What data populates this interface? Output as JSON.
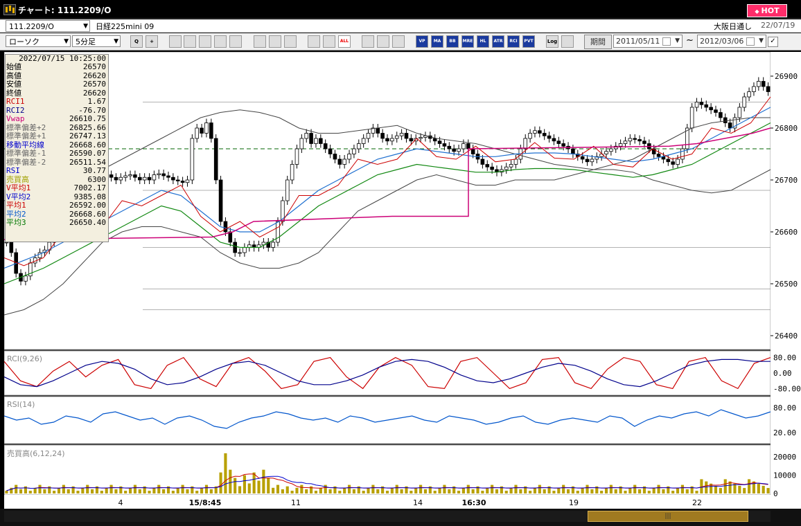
{
  "window": {
    "title": "チャート: 111.2209/O",
    "hot_label": "HOT"
  },
  "bar1": {
    "symbol_value": "111.2209/O",
    "symbol_name": "日経225mini 09",
    "exchange": "大阪日通し",
    "date": "22/07/19"
  },
  "toolbar": {
    "chart_type": "ローソク",
    "interval": "5分足",
    "period_label": "期間",
    "date_from": "2011/05/11",
    "date_to": "2012/03/06",
    "tilde": "~",
    "tools": [
      {
        "icon": "zoom-icon",
        "label": "Q"
      },
      {
        "icon": "crosshair-icon",
        "label": "+"
      },
      {
        "icon": "candle-tool-icon",
        "label": ""
      },
      {
        "icon": "target-icon",
        "label": ""
      },
      {
        "icon": "grid-icon",
        "label": ""
      },
      {
        "icon": "scale-icon",
        "label": ""
      },
      {
        "icon": "info-icon",
        "label": ""
      },
      {
        "icon": "pencil-icon",
        "label": ""
      },
      {
        "icon": "cursor-icon",
        "label": ""
      },
      {
        "icon": "redo-icon",
        "label": ""
      },
      {
        "icon": "zoom-out-icon",
        "label": ""
      },
      {
        "icon": "zoom-in-icon",
        "label": ""
      },
      {
        "icon": "all-icon",
        "label": "ALL"
      },
      {
        "icon": "settings-icon",
        "label": ""
      },
      {
        "icon": "wrench-icon",
        "label": ""
      },
      {
        "icon": "color-icon",
        "label": ""
      },
      {
        "icon": "vp-icon",
        "label": "VP"
      },
      {
        "icon": "ma-icon",
        "label": "MA"
      },
      {
        "icon": "bb-icon",
        "label": "BB"
      },
      {
        "icon": "mre-icon",
        "label": "MRE"
      },
      {
        "icon": "hl-icon",
        "label": "HL"
      },
      {
        "icon": "atr-icon",
        "label": "ATR"
      },
      {
        "icon": "rci-icon",
        "label": "RCI"
      },
      {
        "icon": "pvt-icon",
        "label": "PVT"
      },
      {
        "icon": "log-icon",
        "label": "Log"
      },
      {
        "icon": "export-icon",
        "label": ""
      }
    ]
  },
  "info_panel": {
    "datetime": "2022/07/15  10:25:00",
    "rows": [
      {
        "label": "始値",
        "value": "26570",
        "color": "#000000"
      },
      {
        "label": "高値",
        "value": "26620",
        "color": "#000000"
      },
      {
        "label": "安値",
        "value": "26570",
        "color": "#000000"
      },
      {
        "label": "終値",
        "value": "26620",
        "color": "#000000"
      },
      {
        "label": "RCI1",
        "value": "1.67",
        "color": "#cc0000"
      },
      {
        "label": "RCI2",
        "value": "-76.70",
        "color": "#00008b"
      },
      {
        "label": "Vwap",
        "value": "26610.75",
        "color": "#cc0077"
      },
      {
        "label": "標準偏差+2",
        "value": "26825.66",
        "color": "#666666"
      },
      {
        "label": "標準偏差+1",
        "value": "26747.13",
        "color": "#666666"
      },
      {
        "label": "移動平均線",
        "value": "26668.60",
        "color": "#0000cc"
      },
      {
        "label": "標準偏差-1",
        "value": "26590.07",
        "color": "#666666"
      },
      {
        "label": "標準偏差-2",
        "value": "26511.54",
        "color": "#666666"
      },
      {
        "label": "RSI",
        "value": "30.77",
        "color": "#0000cc"
      },
      {
        "label": "売買高",
        "value": "6300",
        "color": "#a0a000"
      },
      {
        "label": "V平均1",
        "value": "7002.17",
        "color": "#cc0000"
      },
      {
        "label": "V平均2",
        "value": "9385.08",
        "color": "#0000cc"
      },
      {
        "label": "平均1",
        "value": "26592.00",
        "color": "#cc0000"
      },
      {
        "label": "平均2",
        "value": "26668.60",
        "color": "#0055cc"
      },
      {
        "label": "平均3",
        "value": "26650.40",
        "color": "#007700"
      }
    ]
  },
  "chart_data": [
    {
      "type": "candlestick",
      "ylim": [
        26380,
        26940
      ],
      "y_ticks": [
        26900,
        26800,
        26700,
        26600,
        26500,
        26400
      ],
      "x_ticks": [
        "4",
        "15/8:45",
        "11",
        "14",
        "16:30",
        "19",
        "22"
      ],
      "x_tick_bold": [
        false,
        true,
        false,
        false,
        true,
        false,
        false
      ],
      "closes": [
        26580,
        26560,
        26520,
        26505,
        26515,
        26540,
        26550,
        26560,
        26565,
        26580,
        26590,
        26605,
        26620,
        26640,
        26650,
        26660,
        26670,
        26680,
        26690,
        26700,
        26705,
        26710,
        26705,
        26700,
        26705,
        26708,
        26710,
        26705,
        26700,
        26705,
        26700,
        26710,
        26712,
        26708,
        26705,
        26700,
        26698,
        26695,
        26700,
        26780,
        26800,
        26790,
        26810,
        26780,
        26700,
        26620,
        26600,
        26580,
        26560,
        26560,
        26570,
        26575,
        26570,
        26575,
        26580,
        26570,
        26580,
        26620,
        26660,
        26700,
        26730,
        26760,
        26780,
        26790,
        26770,
        26780,
        26770,
        26760,
        26750,
        26740,
        26730,
        26740,
        26750,
        26760,
        26770,
        26780,
        26790,
        26800,
        26790,
        26780,
        26775,
        26780,
        26785,
        26790,
        26780,
        26775,
        26780,
        26782,
        26785,
        26780,
        26775,
        26770,
        26765,
        26760,
        26755,
        26760,
        26770,
        26760,
        26750,
        26740,
        26730,
        26725,
        26720,
        26715,
        26720,
        26725,
        26730,
        26740,
        26760,
        26780,
        26790,
        26795,
        26790,
        26785,
        26780,
        26775,
        26770,
        26765,
        26760,
        26750,
        26745,
        26740,
        26735,
        26740,
        26745,
        26750,
        26755,
        26760,
        26765,
        26770,
        26775,
        26780,
        26778,
        26775,
        26770,
        26760,
        26750,
        26745,
        26740,
        26735,
        26730,
        26740,
        26760,
        26800,
        26840,
        26850,
        26845,
        26840,
        26835,
        26830,
        26820,
        26810,
        26800,
        26820,
        26840,
        26860,
        26870,
        26880,
        26890,
        26880,
        26870
      ],
      "bb_upper": [
        26660,
        26670,
        26680,
        26690,
        26700,
        26720,
        26740,
        26760,
        26780,
        26800,
        26820,
        26830,
        26835,
        26830,
        26820,
        26800,
        26790,
        26790,
        26795,
        26800,
        26805,
        26790,
        26780,
        26775,
        26770,
        26760,
        26750,
        26740,
        26730,
        26725,
        26720,
        26730,
        26740,
        26760,
        26780,
        26800,
        26810,
        26815,
        26820,
        26820
      ],
      "bb_lower": [
        26440,
        26450,
        26470,
        26500,
        26540,
        26580,
        26600,
        26610,
        26610,
        26600,
        26590,
        26560,
        26540,
        26530,
        26530,
        26540,
        26560,
        26600,
        26640,
        26660,
        26680,
        26700,
        26710,
        26700,
        26690,
        26690,
        26700,
        26700,
        26700,
        26710,
        26720,
        26720,
        26715,
        26700,
        26690,
        26680,
        26675,
        26680,
        26700,
        26720
      ],
      "ma": [
        26530,
        26545,
        26560,
        26580,
        26600,
        26620,
        26640,
        26660,
        26680,
        26670,
        26640,
        26610,
        26600,
        26600,
        26620,
        26650,
        26680,
        26700,
        26720,
        26740,
        26750,
        26760,
        26755,
        26750,
        26745,
        26745,
        26750,
        26752,
        26752,
        26750,
        26745,
        26740,
        26735,
        26740,
        26750,
        26760,
        26780,
        26800,
        26820,
        26840
      ],
      "vwap_steps": [
        [
          0,
          26585
        ],
        [
          300,
          26590
        ],
        [
          330,
          26600
        ],
        [
          360,
          26620
        ],
        [
          560,
          26630
        ],
        [
          670,
          26630
        ],
        [
          670,
          26760
        ],
        [
          960,
          26765
        ],
        [
          1000,
          26770
        ],
        [
          1080,
          26790
        ],
        [
          1106,
          26800
        ]
      ]
    },
    {
      "type": "line",
      "name_label": "RCI(9,26)",
      "y_ticks": [
        "80.00",
        "0.00",
        "-80.00"
      ],
      "series": [
        {
          "color": "#cc0000",
          "values": [
            60,
            -40,
            -70,
            10,
            60,
            -20,
            40,
            70,
            -60,
            -80,
            40,
            80,
            -30,
            -70,
            50,
            80,
            10,
            -80,
            -60,
            60,
            80,
            -20,
            -80,
            30,
            80,
            40,
            -70,
            -80,
            60,
            80,
            0,
            -80,
            -50,
            70,
            80,
            -50,
            -80,
            20,
            80,
            60,
            -60,
            -80,
            60,
            80,
            -40,
            -80,
            50,
            80
          ]
        },
        {
          "color": "#00008b",
          "values": [
            -20,
            -60,
            -70,
            -40,
            0,
            40,
            60,
            50,
            20,
            -30,
            -60,
            -50,
            -20,
            20,
            50,
            60,
            40,
            0,
            -40,
            -60,
            -60,
            -40,
            -10,
            30,
            60,
            70,
            60,
            30,
            -10,
            -40,
            -50,
            -30,
            0,
            30,
            50,
            40,
            10,
            -30,
            -60,
            -70,
            -40,
            0,
            40,
            60,
            70,
            70,
            60,
            60
          ]
        }
      ]
    },
    {
      "type": "line",
      "name_label": "RSI(14)",
      "y_ticks": [
        "80.00",
        "20.00"
      ],
      "series": [
        {
          "color": "#0055cc",
          "values": [
            60,
            50,
            55,
            40,
            45,
            60,
            55,
            45,
            65,
            70,
            60,
            50,
            55,
            40,
            55,
            60,
            50,
            35,
            30,
            45,
            55,
            60,
            70,
            65,
            55,
            50,
            55,
            45,
            60,
            55,
            45,
            50,
            55,
            60,
            50,
            45,
            60,
            55,
            50,
            40,
            45,
            55,
            60,
            45,
            40,
            50,
            55,
            50,
            45,
            60,
            55,
            35,
            50,
            60,
            55,
            65,
            70,
            60,
            75,
            65,
            55,
            60,
            70
          ]
        }
      ]
    },
    {
      "type": "bar",
      "name_label": "売買高(6,12,24)",
      "y_ticks": [
        "20000",
        "10000",
        "0"
      ],
      "ylim": [
        0,
        25000
      ]
    }
  ]
}
